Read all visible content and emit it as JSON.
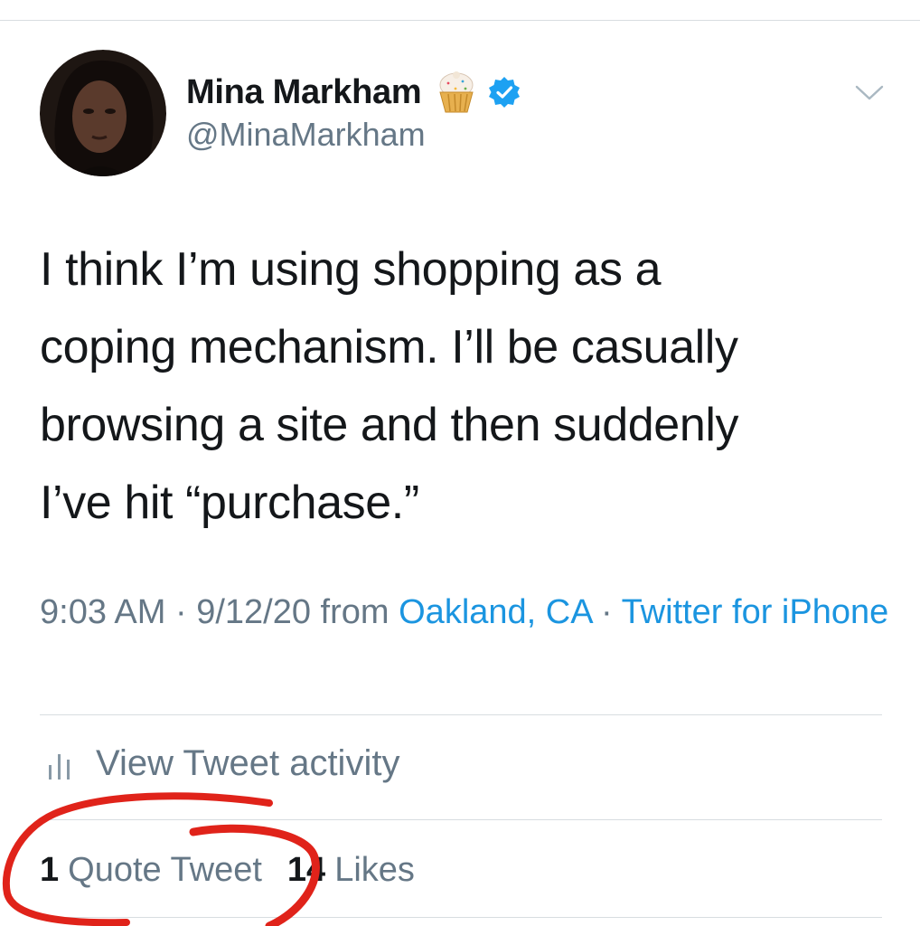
{
  "author": {
    "display_name": "Mina Markham",
    "handle": "@MinaMarkham",
    "name_emoji": "cupcake-emoji",
    "verified_icon": "verified-badge-icon",
    "verified_color": "#1da1f2"
  },
  "tweet": {
    "lines": [
      "I think I’m using shopping as a",
      "coping mechanism. I’ll be casually",
      "browsing a site and then suddenly",
      "I’ve hit “purchase.”"
    ]
  },
  "meta": {
    "time": "9:03 AM",
    "separator1": " · ",
    "date": "9/12/20",
    "from_text": " from ",
    "location": "Oakland, CA",
    "separator2": " · ",
    "source": "Twitter for iPhone",
    "link_color": "#1b95e0"
  },
  "activity": {
    "label": "View Tweet activity",
    "icon": "bar-chart-icon"
  },
  "stats": {
    "quote_count": "1",
    "quote_label": "Quote Tweet",
    "like_count": "14",
    "like_label": "Likes"
  },
  "annotation": {
    "color": "#e0231a",
    "icon": "red-circle-markup"
  }
}
